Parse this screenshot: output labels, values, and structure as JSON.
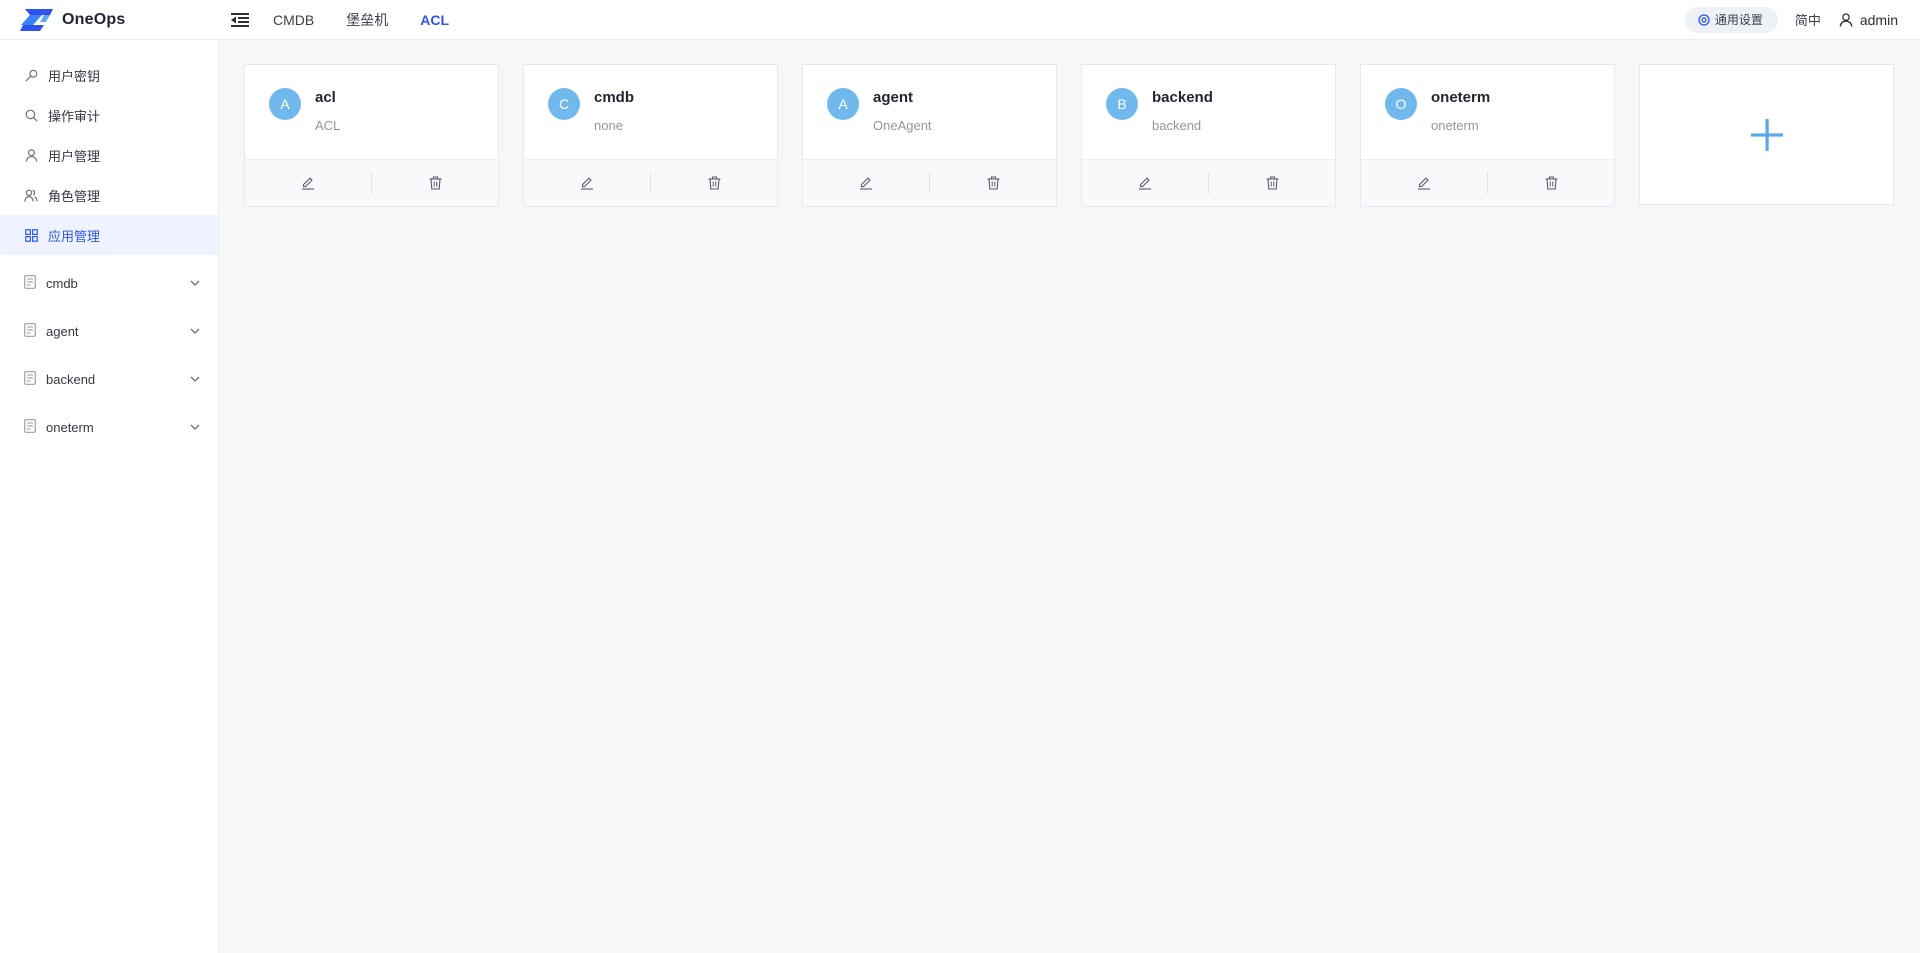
{
  "app": {
    "name": "OneOps"
  },
  "nav": {
    "items": [
      {
        "label": "CMDB",
        "active": false
      },
      {
        "label": "堡垒机",
        "active": false
      },
      {
        "label": "ACL",
        "active": true
      }
    ]
  },
  "topbar": {
    "settings_label": "通用设置",
    "lang_label": "简中",
    "user_name": "admin"
  },
  "sidebar": {
    "items": [
      {
        "label": "用户密钥",
        "icon": "key-icon",
        "active": false
      },
      {
        "label": "操作审计",
        "icon": "search-icon",
        "active": false
      },
      {
        "label": "用户管理",
        "icon": "user-icon",
        "active": false
      },
      {
        "label": "角色管理",
        "icon": "users-icon",
        "active": false
      },
      {
        "label": "应用管理",
        "icon": "grid-icon",
        "active": true
      }
    ],
    "groups": [
      {
        "label": "cmdb",
        "icon": "doc-icon"
      },
      {
        "label": "agent",
        "icon": "doc-icon"
      },
      {
        "label": "backend",
        "icon": "doc-icon"
      },
      {
        "label": "oneterm",
        "icon": "doc-icon"
      }
    ]
  },
  "apps": [
    {
      "initial": "A",
      "name": "acl",
      "desc": "ACL"
    },
    {
      "initial": "C",
      "name": "cmdb",
      "desc": "none"
    },
    {
      "initial": "A",
      "name": "agent",
      "desc": "OneAgent"
    },
    {
      "initial": "B",
      "name": "backend",
      "desc": "backend"
    },
    {
      "initial": "O",
      "name": "oneterm",
      "desc": "oneterm"
    }
  ],
  "add_card": {
    "symbol": "+"
  },
  "colors": {
    "accent": "#2f54eb",
    "avatar": "#71b9ec",
    "active_bg": "#eef3ff"
  }
}
